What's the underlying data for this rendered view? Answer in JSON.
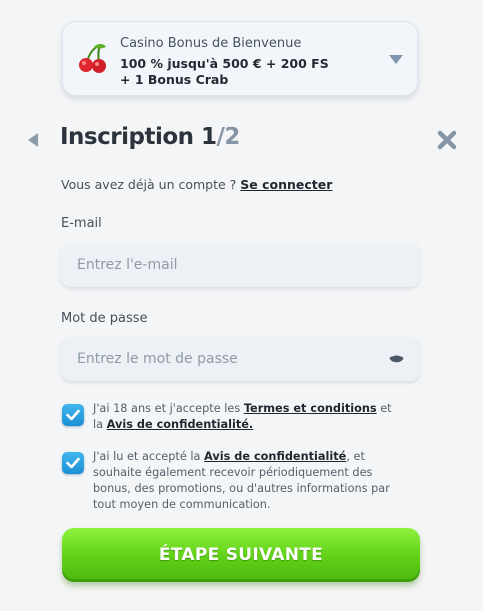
{
  "bonus": {
    "label": "Casino Bonus de Bienvenue",
    "offer_line1": "100 % jusqu'à 500 € + 200 FS",
    "offer_line2": "+ 1 Bonus Crab",
    "icon": "cherry-icon"
  },
  "header": {
    "title": "Inscription 1",
    "step_total": "/2"
  },
  "account": {
    "prompt": "Vous avez déjà un compte ? ",
    "login_link": "Se connecter"
  },
  "email": {
    "label": "E-mail",
    "placeholder": "Entrez l'e-mail",
    "value": ""
  },
  "password": {
    "label": "Mot de passe",
    "placeholder": "Entrez le mot de passe",
    "value": ""
  },
  "consent1": {
    "checked": true,
    "text_before": "J'ai 18 ans et j'accepte les ",
    "terms_link": "Termes et conditions",
    "text_mid": " et la ",
    "privacy_link": "Avis de confidentialité."
  },
  "consent2": {
    "checked": true,
    "text_before": "J'ai lu et accepté la ",
    "privacy_link": "Avis de confidentialité",
    "text_after": ", et souhaite également recevoir périodiquement des bonus, des promotions, ou d'autres informations par tout moyen de communication."
  },
  "next_button": {
    "label": "ÉTAPE SUIVANTE"
  },
  "colors": {
    "accent_green": "#5fcf17",
    "checkbox_blue": "#1b8fd3",
    "background": "#f4f5f6"
  }
}
